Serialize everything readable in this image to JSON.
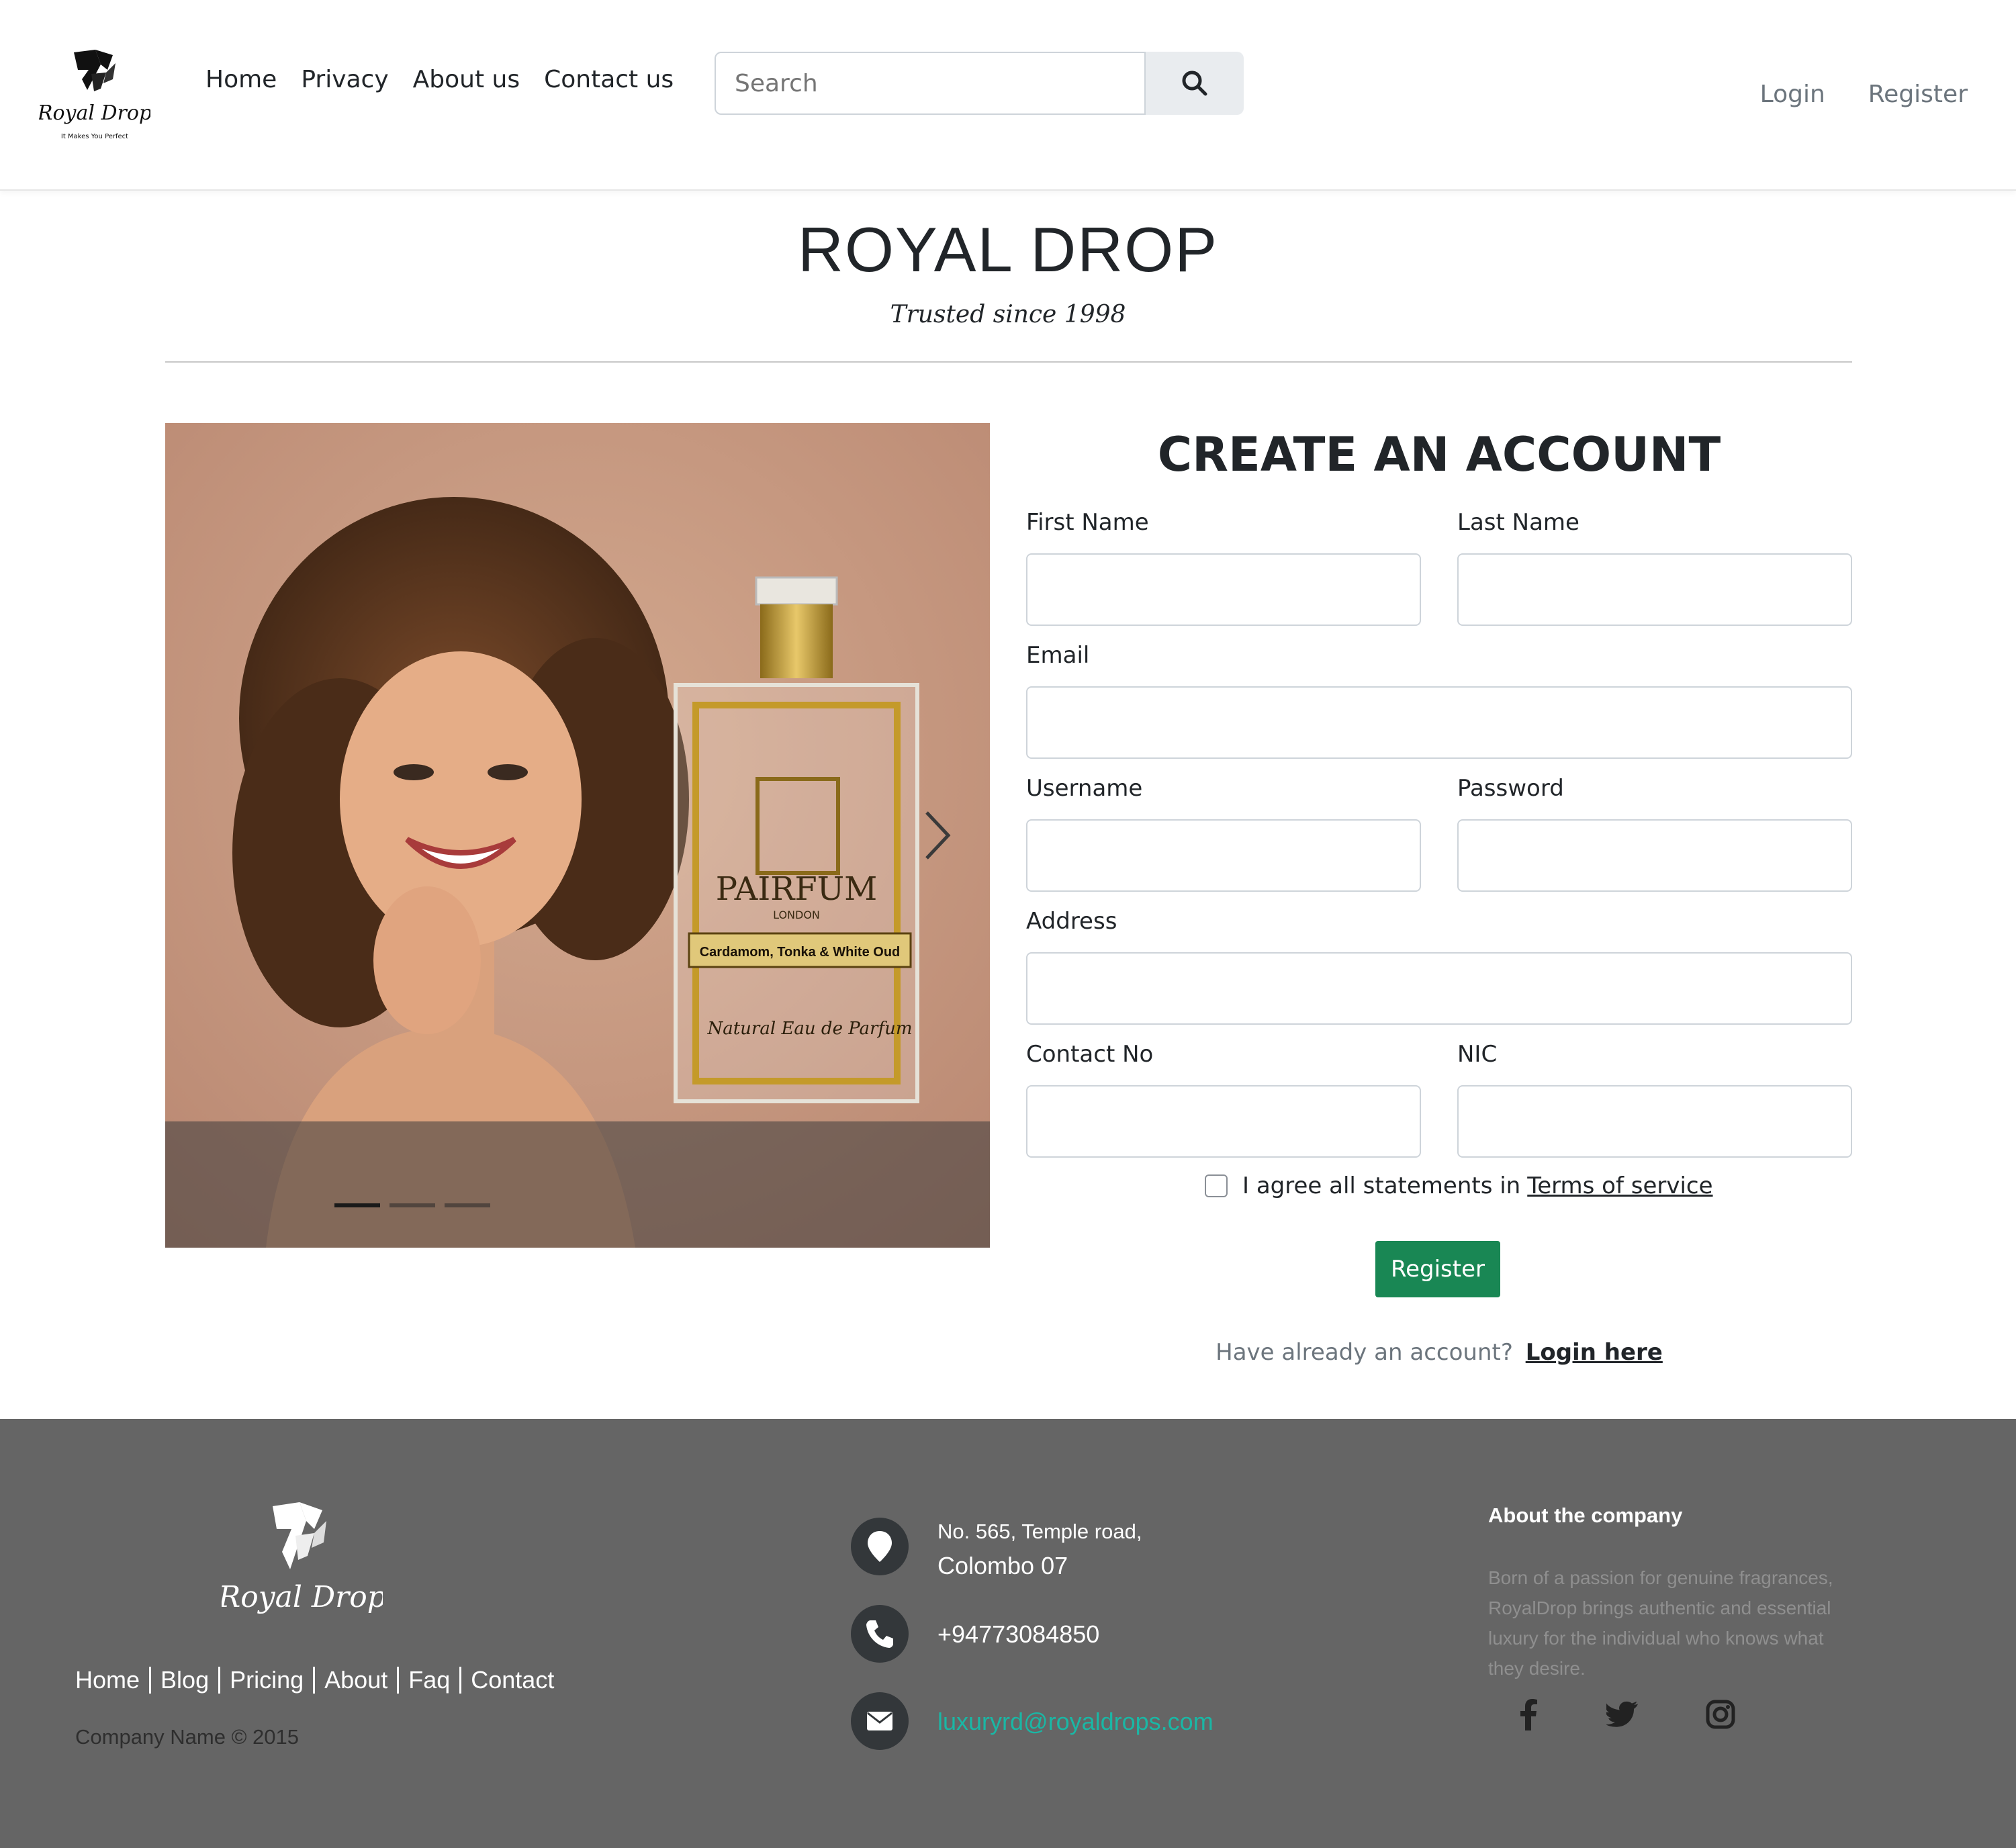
{
  "nav": {
    "logo_text": "Royal Drop",
    "logo_tagline": "It Makes You Perfect",
    "links": [
      "Home",
      "Privacy",
      "About us",
      "Contact us"
    ],
    "search_placeholder": "Search",
    "login": "Login",
    "register": "Register"
  },
  "header": {
    "title": "ROYAL DROP",
    "subtitle": "Trusted since 1998"
  },
  "carousel": {
    "bottle_brand": "PAIRFUM",
    "bottle_city": "LONDON",
    "bottle_label": "Cardamom, Tonka & White Oud",
    "bottle_type": "Natural Eau de Parfum",
    "slide_count": 3,
    "active_index": 0
  },
  "form": {
    "title": "CREATE AN ACCOUNT",
    "labels": {
      "first_name": "First Name",
      "last_name": "Last Name",
      "email": "Email",
      "username": "Username",
      "password": "Password",
      "address": "Address",
      "contact_no": "Contact No",
      "nic": "NIC"
    },
    "values": {
      "first_name": "",
      "last_name": "",
      "email": "",
      "username": "",
      "password": "",
      "address": "",
      "contact_no": "",
      "nic": ""
    },
    "terms_text": "I agree all statements in",
    "terms_link": "Terms of service",
    "submit": "Register",
    "login_prompt": "Have already an account?",
    "login_link": "Login here"
  },
  "footer": {
    "logo_text": "Royal Drop",
    "links": [
      "Home",
      "Blog",
      "Pricing",
      "About",
      "Faq",
      "Contact"
    ],
    "copyright": "Company Name © 2015",
    "address_line1": "No. 565, Temple road,",
    "address_line2": "Colombo 07",
    "phone": "+94773084850",
    "email": "luxuryrd@royaldrops.com",
    "about_title": "About the company",
    "about_text": "Born of a passion for genuine fragrances, RoyalDrop brings authentic and essential luxury for the individual who knows what they desire.",
    "social": [
      "facebook-icon",
      "twitter-icon",
      "instagram-icon"
    ]
  },
  "colors": {
    "register_button": "#198754",
    "footer_bg": "#656565",
    "footer_email": "#1ab7a5",
    "contact_icon_bg": "#33373a"
  }
}
